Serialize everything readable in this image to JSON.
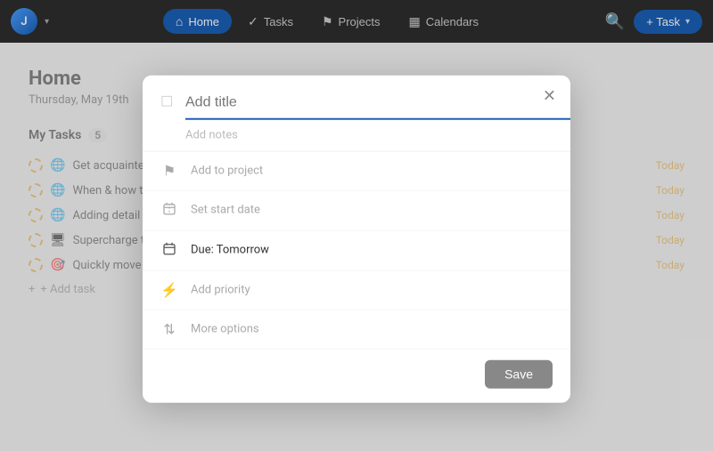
{
  "nav": {
    "avatar_initial": "J",
    "buttons": [
      {
        "label": "Home",
        "icon": "⌂",
        "active": true
      },
      {
        "label": "Tasks",
        "icon": "✓"
      },
      {
        "label": "Projects",
        "icon": "⚑"
      },
      {
        "label": "Calendars",
        "icon": "▦"
      }
    ],
    "add_task_label": "+ Task"
  },
  "page": {
    "title": "Home",
    "subtitle": "Thursday, May 19th"
  },
  "tasks_section": {
    "title": "My Tasks",
    "badge": "5",
    "tasks": [
      {
        "label": "Get acquainted w",
        "icon": "🌐",
        "date": "Today"
      },
      {
        "label": "When & how to c",
        "icon": "🌐",
        "date": "Today"
      },
      {
        "label": "Adding detail to",
        "icon": "🌐",
        "date": "Today"
      },
      {
        "label": "Supercharge tas",
        "icon": "🖥",
        "date": "Today"
      },
      {
        "label": "Quickly move ta",
        "icon": "🎯",
        "date": "Today"
      }
    ],
    "add_task_label": "+ Add task"
  },
  "modal": {
    "title_placeholder": "Add title",
    "notes_placeholder": "Add notes",
    "rows": [
      {
        "icon": "⚑",
        "label": "Add to project",
        "type": "action"
      },
      {
        "icon": "▦",
        "label": "Set start date",
        "type": "action"
      },
      {
        "icon": "📅",
        "label": "Due: Tomorrow",
        "type": "due"
      },
      {
        "icon": "⚡",
        "label": "Add priority",
        "type": "action"
      },
      {
        "icon": "⇅",
        "label": "More options",
        "type": "action"
      }
    ],
    "save_label": "Save"
  }
}
